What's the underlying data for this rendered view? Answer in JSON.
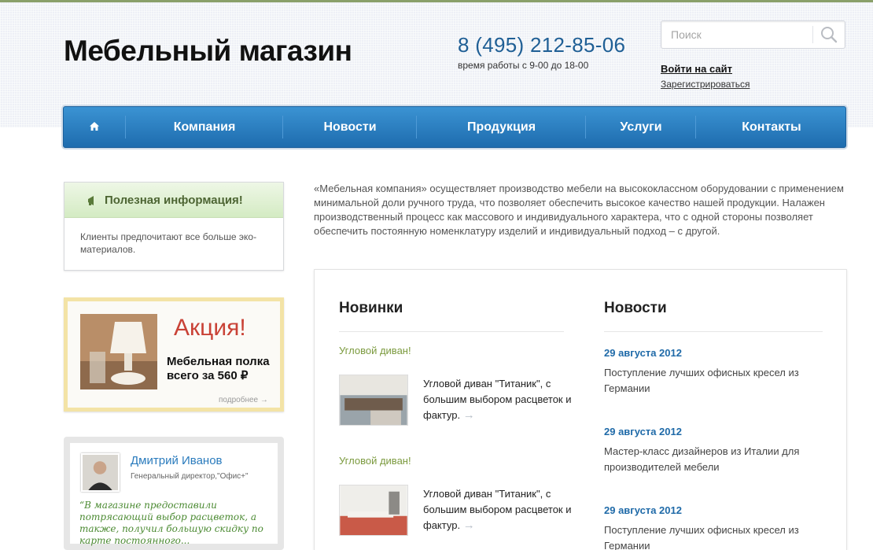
{
  "header": {
    "site_title": "Мебельный магазин",
    "phone": "8 (495) 212-85-06",
    "hours": "время работы с 9-00 до 18-00",
    "search_placeholder": "Поиск",
    "login": "Войти на сайт",
    "register": "Зарегистрироваться"
  },
  "nav": {
    "home_icon": "home-icon",
    "items": [
      "Компания",
      "Новости",
      "Продукция",
      "Услуги",
      "Контакты"
    ]
  },
  "sidebar": {
    "info": {
      "icon": "megaphone-icon",
      "title": "Полезная информация!",
      "text": "Клиенты предпочитают все больше эко-материалов."
    },
    "promo": {
      "title": "Акция!",
      "line1": "Мебельная полка",
      "line2": "всего за 560 ₽",
      "more": "подробнее →"
    },
    "testimonial": {
      "name": "Дмитрий Иванов",
      "role": "Генеральный директор,\"Офис+\"",
      "quote": "“В магазине предоставили потрясающий выбор расцветок, а также, получил большую скидку по карте постоянного..."
    }
  },
  "main": {
    "intro": "«Мебельная компания» осуществляет производство мебели на высококлассном оборудовании с применением минимальной доли ручного труда, что позволяет обеспечить высокое качество нашей продукции. Налажен производственный процесс как массового и индивидуального характера, что с одной стороны позволяет обеспечить постоянную номенклатуру изделий и индивидуальный подход – с другой.",
    "new_title": "Новинки",
    "new_items": [
      {
        "category": "Угловой диван!",
        "description": "Угловой диван \"Титаник\", с большим выбором расцветок и фактур."
      },
      {
        "category": "Угловой диван!",
        "description": "Угловой диван \"Титаник\", с большим выбором расцветок и фактур."
      }
    ],
    "news_title": "Новости",
    "news_items": [
      {
        "date": "29 августа 2012",
        "text": "Поступление лучших офисных кресел из Германии"
      },
      {
        "date": "29 августа 2012",
        "text": "Мастер-класс дизайнеров из Италии для производителей мебели"
      },
      {
        "date": "29 августа 2012",
        "text": "Поступление лучших офисных кресел из Германии"
      }
    ],
    "arrow": "→"
  },
  "colors": {
    "nav_blue": "#1e6cae",
    "phone_blue": "#1f5f95",
    "promo_red": "#c94236",
    "green": "#7b9a3e"
  }
}
